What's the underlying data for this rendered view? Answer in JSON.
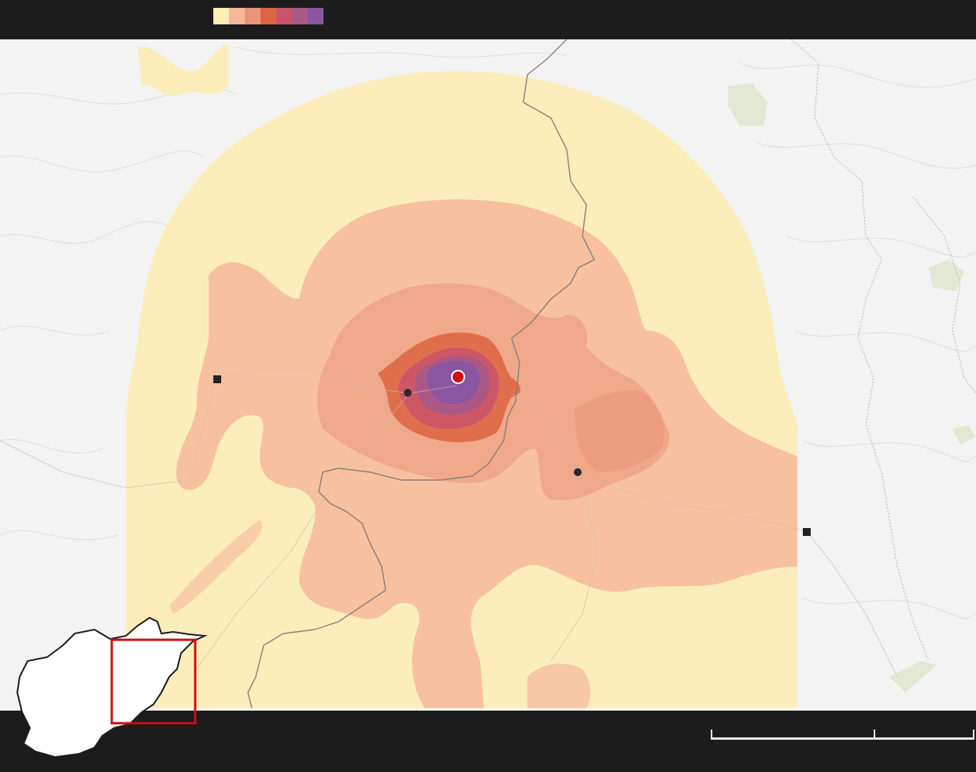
{
  "legend": {
    "intensity_colors": [
      "#fdeeb6",
      "#f6b89a",
      "#ea9478",
      "#dc6442",
      "#c9546a",
      "#a85a87",
      "#8b56a0"
    ]
  },
  "map": {
    "background": "#f3f3f3",
    "epicenter_color": "#cc1111"
  }
}
